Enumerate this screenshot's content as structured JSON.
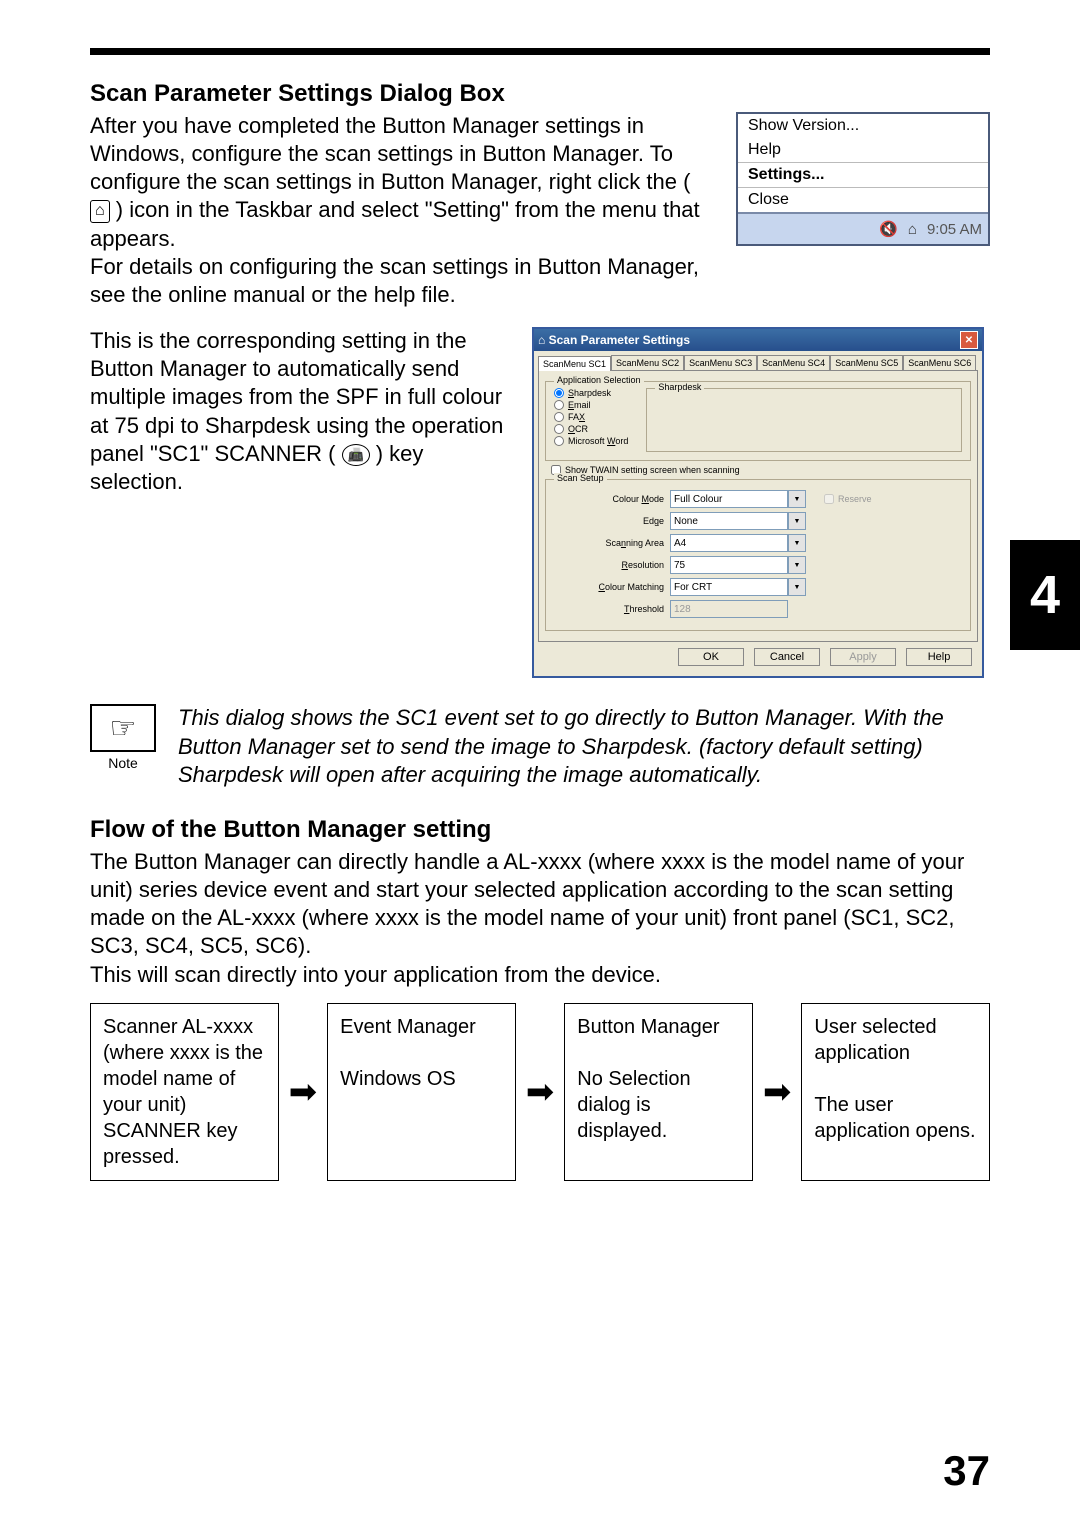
{
  "chapter_tab": "4",
  "page_number": "37",
  "section1": {
    "heading": "Scan Parameter Settings Dialog Box",
    "p1a": "After you have completed the Button Manager settings in Windows, configure the scan settings in Button Manager. To configure the scan settings in Button Manager, right click the (",
    "p1b": ") icon in the Taskbar and select \"Setting\" from the menu that appears.",
    "p2": "For details on configuring the scan settings in Button Manager, see the online manual or the help file.",
    "p3a": "This is the corresponding setting in the Button Manager to automatically send multiple images from the SPF in full colour at 75 dpi to Sharpdesk using the operation panel \"SC1\" SCANNER (",
    "p3b": ") key selection."
  },
  "context_menu": {
    "items": [
      "Show Version...",
      "Help",
      "Settings...",
      "Close"
    ],
    "tray_time": "9:05 AM"
  },
  "sps": {
    "title": "Scan Parameter Settings",
    "tabs": [
      "ScanMenu SC1",
      "ScanMenu SC2",
      "ScanMenu SC3",
      "ScanMenu SC4",
      "ScanMenu SC5",
      "ScanMenu SC6"
    ],
    "group_app_sel": "Application Selection",
    "apps": [
      "Sharpdesk",
      "Email",
      "FAX",
      "OCR",
      "Microsoft Word"
    ],
    "inner_group": "Sharpdesk",
    "twain_label": "Show TWAIN setting screen when scanning",
    "group_scan_setup": "Scan Setup",
    "rows": {
      "colour_mode": {
        "label": "Colour Mode",
        "value": "Full Colour"
      },
      "edge": {
        "label": "Edge",
        "value": "None"
      },
      "scanning_area": {
        "label": "Scanning Area",
        "value": "A4"
      },
      "resolution": {
        "label": "Resolution",
        "value": "75"
      },
      "colour_matching": {
        "label": "Colour Matching",
        "value": "For CRT"
      },
      "threshold": {
        "label": "Threshold",
        "value": "128"
      }
    },
    "reserve": "Reserve",
    "buttons": {
      "ok": "OK",
      "cancel": "Cancel",
      "apply": "Apply",
      "help": "Help"
    }
  },
  "note": {
    "label": "Note",
    "text": "This dialog shows the SC1 event set to go directly to Button Manager. With the Button Manager set to send the image to Sharpdesk. (factory default setting) Sharpdesk will open after acquiring the image automatically."
  },
  "section2": {
    "heading": "Flow of the Button Manager setting",
    "p1": "The Button Manager can directly handle a AL-xxxx (where xxxx is the model name of your unit) series device event and start your selected application according to the scan setting made on the AL-xxxx (where xxxx is the model name of your unit) front panel (SC1, SC2, SC3, SC4, SC5, SC6).",
    "p2": "This will scan directly into your application from the device."
  },
  "flow": {
    "b1": "Scanner AL-xxxx (where xxxx is the model name of your unit) SCANNER key pressed.",
    "b2a": "Event Manager",
    "b2b": "Windows OS",
    "b3a": "Button Manager",
    "b3b": "No Selection dialog is displayed.",
    "b4a": "User selected application",
    "b4b": "The user application opens."
  }
}
